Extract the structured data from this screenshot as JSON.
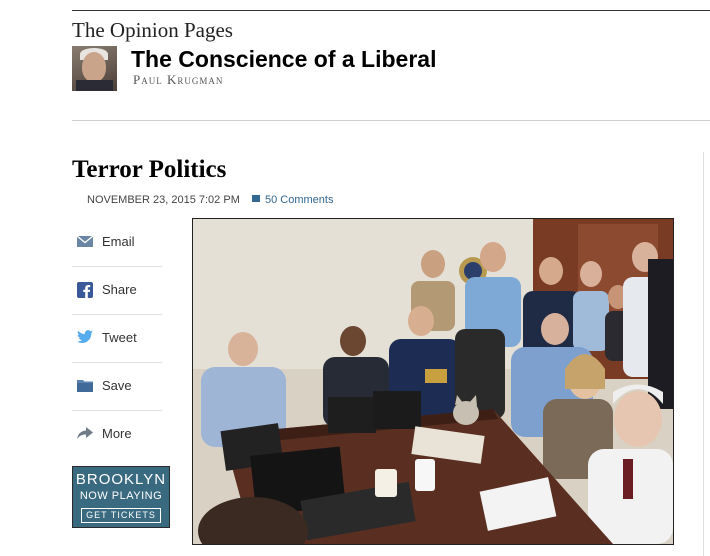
{
  "header": {
    "section": "The Opinion Pages",
    "blog_title": "The Conscience of a Liberal",
    "author": "Paul Krugman"
  },
  "article": {
    "headline": "Terror Politics",
    "date": "NOVEMBER 23, 2015 7:02 PM",
    "comments": "50 Comments"
  },
  "share_tools": [
    {
      "label": "Email",
      "icon": "envelope-icon"
    },
    {
      "label": "Share",
      "icon": "facebook-icon"
    },
    {
      "label": "Tweet",
      "icon": "twitter-icon"
    },
    {
      "label": "Save",
      "icon": "folder-icon"
    },
    {
      "label": "More",
      "icon": "share-arrow-icon"
    }
  ],
  "ad": {
    "line1": "BROOKLYN",
    "line2": "NOW PLAYING",
    "cta": "GET TICKETS"
  },
  "colors": {
    "link": "#326891",
    "ad_bg": "#3a6a80"
  }
}
